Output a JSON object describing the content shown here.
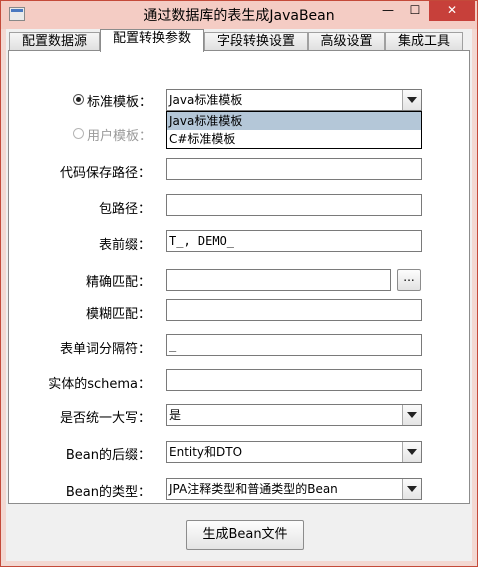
{
  "window": {
    "title": "通过数据库的表生成JavaBean",
    "minimize_label": "—",
    "maximize_label": "☐",
    "close_label": "✕"
  },
  "tabs": [
    {
      "label": "配置数据源"
    },
    {
      "label": "配置转换参数"
    },
    {
      "label": "字段转换设置"
    },
    {
      "label": "高级设置"
    },
    {
      "label": "集成工具"
    }
  ],
  "template": {
    "standard_label": "标准模板：",
    "standard_value": "Java标准模板",
    "user_label": "用户模板：",
    "options": [
      "Java标准模板",
      "C#标准模板"
    ]
  },
  "form": {
    "code_path": {
      "label": "代码保存路径：",
      "value": ""
    },
    "package_path": {
      "label": "包路径：",
      "value": ""
    },
    "table_prefix": {
      "label": "表前缀：",
      "value": "T_, DEMO_"
    },
    "exact_match": {
      "label": "精确匹配：",
      "value": "",
      "browse_label": "..."
    },
    "fuzzy_match": {
      "label": "模糊匹配：",
      "value": ""
    },
    "word_separator": {
      "label": "表单词分隔符：",
      "value": "_"
    },
    "entity_schema": {
      "label": "实体的schema：",
      "value": ""
    },
    "uppercase": {
      "label": "是否统一大写：",
      "value": "是"
    },
    "bean_suffix": {
      "label": "Bean的后缀：",
      "value": "Entity和DTO"
    },
    "bean_type": {
      "label": "Bean的类型：",
      "value": "JPA注释类型和普通类型的Bean"
    }
  },
  "generate_button": "生成Bean文件"
}
